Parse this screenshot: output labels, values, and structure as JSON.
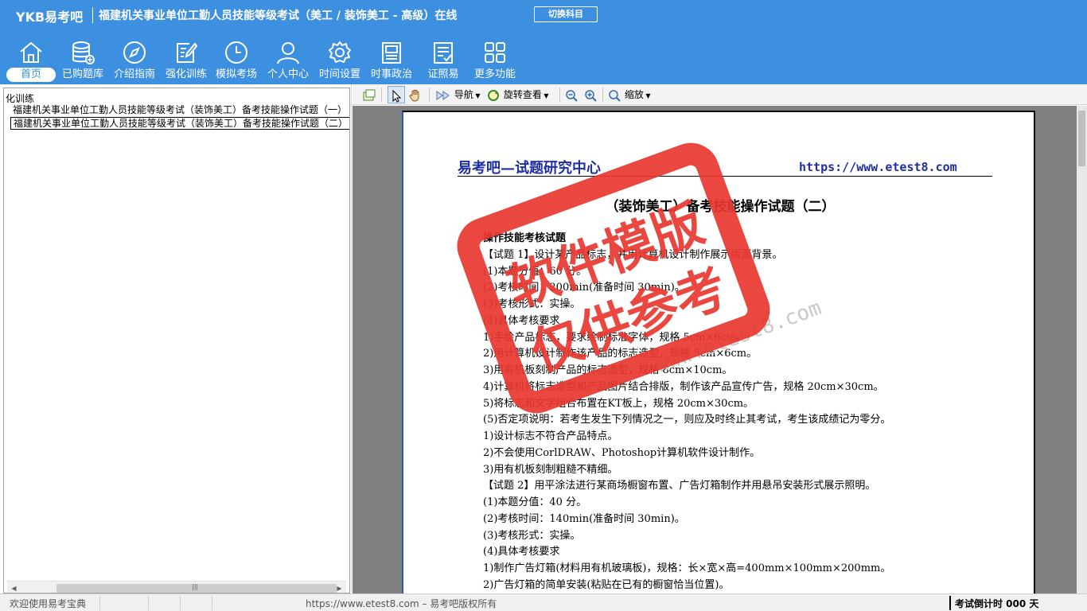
{
  "header": {
    "brand": "YKB易考吧",
    "exam_title": "福建机关事业单位工勤人员技能等级考试（美工 / 装饰美工 - 高级）在线",
    "switch_label": "切换科目"
  },
  "nav": [
    {
      "label": "首页",
      "icon": "home-icon"
    },
    {
      "label": "已购题库",
      "icon": "database-icon"
    },
    {
      "label": "介绍指南",
      "icon": "compass-icon"
    },
    {
      "label": "强化训练",
      "icon": "edit-icon"
    },
    {
      "label": "模拟考场",
      "icon": "clock-icon"
    },
    {
      "label": "个人中心",
      "icon": "user-icon"
    },
    {
      "label": "时间设置",
      "icon": "gear-icon"
    },
    {
      "label": "时事政治",
      "icon": "news-icon"
    },
    {
      "label": "证照易",
      "icon": "certificate-icon"
    },
    {
      "label": "更多功能",
      "icon": "grid-icon"
    }
  ],
  "tree": {
    "root": "化训练",
    "items": [
      "福建机关事业单位工勤人员技能等级考试（装饰美工）备考技能操作试题（一）",
      "福建机关事业单位工勤人员技能等级考试（装饰美工）备考技能操作试题（二）"
    ],
    "scroll_grip": "|||"
  },
  "toolbar": {
    "nav_label": "导航",
    "rotate_label": "旋转查看",
    "zoom_label": "缩放"
  },
  "document": {
    "header_left": "易考吧—试题研究中心",
    "header_right": "https://www.etest8.com",
    "title": "（装饰美工）备考技能操作试题（二）",
    "lines": [
      {
        "text": "操作技能考核试题",
        "bold": true
      },
      {
        "text": "【试题 1】设计某产品标志，并用计算机设计制作展示版面背景。",
        "bold": false
      },
      {
        "text": "(1)本题分值：60 分。",
        "bold": false
      },
      {
        "text": "(2)考核时间：200min(准备时间 30min)。",
        "bold": false
      },
      {
        "text": "(3)考核形式：实操。",
        "bold": false
      },
      {
        "text": "(4)具体考核要求",
        "bold": false
      },
      {
        "text": "1)手绘产品标志，要求绘制标准字体，规格 5cm×6cm。",
        "bold": false
      },
      {
        "text": "2)用计算机设计制作该产品的标志造型，规格 5cm×6cm。",
        "bold": false
      },
      {
        "text": "3)用有机板刻制产品的标志造型，规格 8cm×10cm。",
        "bold": false
      },
      {
        "text": "4)计算机将标志造型和产品图片结合排版，制作该产品宣传广告，规格 20cm×30cm。",
        "bold": false
      },
      {
        "text": "5)将标志和文字组合布置在KT板上，规格 20cm×30cm。",
        "bold": false
      },
      {
        "text": "(5)否定项说明：若考生发生下列情况之一，则应及时终止其考试，考生该成绩记为零分。",
        "bold": false
      },
      {
        "text": "1)设计标志不符合产品特点。",
        "bold": false
      },
      {
        "text": "2)不会使用CorlDRAW、Photoshop计算机软件设计制作。",
        "bold": false
      },
      {
        "text": "3)用有机板刻制粗糙不精细。",
        "bold": false
      },
      {
        "text": "【试题 2】用平涂法进行某商场橱窗布置、广告灯箱制作并用悬吊安装形式展示照明。",
        "bold": false
      },
      {
        "text": "(1)本题分值：40 分。",
        "bold": false
      },
      {
        "text": "(2)考核时间：140min(准备时间 30min)。",
        "bold": false
      },
      {
        "text": "(3)考核形式：实操。",
        "bold": false
      },
      {
        "text": "(4)具体考核要求",
        "bold": false
      },
      {
        "text": "1)制作广告灯箱(材料用有机玻璃板)，规格：长×宽×高=400mm×100mm×200mm。",
        "bold": false
      },
      {
        "text": "2)广告灯箱的简单安装(粘贴在已有的橱窗恰当位置)。",
        "bold": false
      }
    ]
  },
  "watermark": {
    "line1": "软件模版",
    "line2": "仅供参考",
    "url": "www.etest8.com"
  },
  "status": {
    "welcome": "欢迎使用易考宝典",
    "copyright": "https://www.etest8.com – 易考吧版权所有",
    "countdown": "考试倒计时 000 天"
  },
  "colors": {
    "header_bg": "#3d8fe0",
    "doc_blue": "#1f2ea0",
    "watermark_red": "#e8382f"
  }
}
